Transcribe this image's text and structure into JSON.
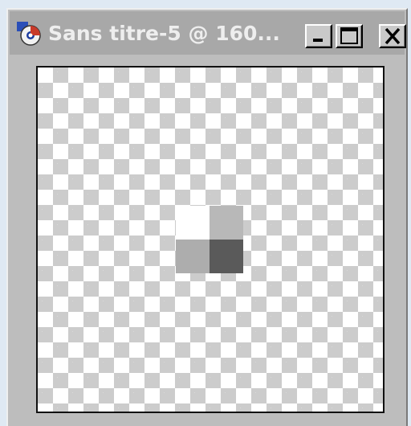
{
  "window": {
    "title": "Sans titre-5 @ 160...",
    "icon": "psp-app-icon",
    "controls": [
      "minimize",
      "maximize",
      "close"
    ]
  },
  "canvas": {
    "background": "transparency-checkerboard",
    "pixels": [
      {
        "name": "pixel-white",
        "color": "#ffffff"
      },
      {
        "name": "pixel-light-gray",
        "color": "#b8b8b8"
      },
      {
        "name": "pixel-mid-gray",
        "color": "#adadad"
      },
      {
        "name": "pixel-dark-gray",
        "color": "#5a5a5a"
      }
    ]
  }
}
